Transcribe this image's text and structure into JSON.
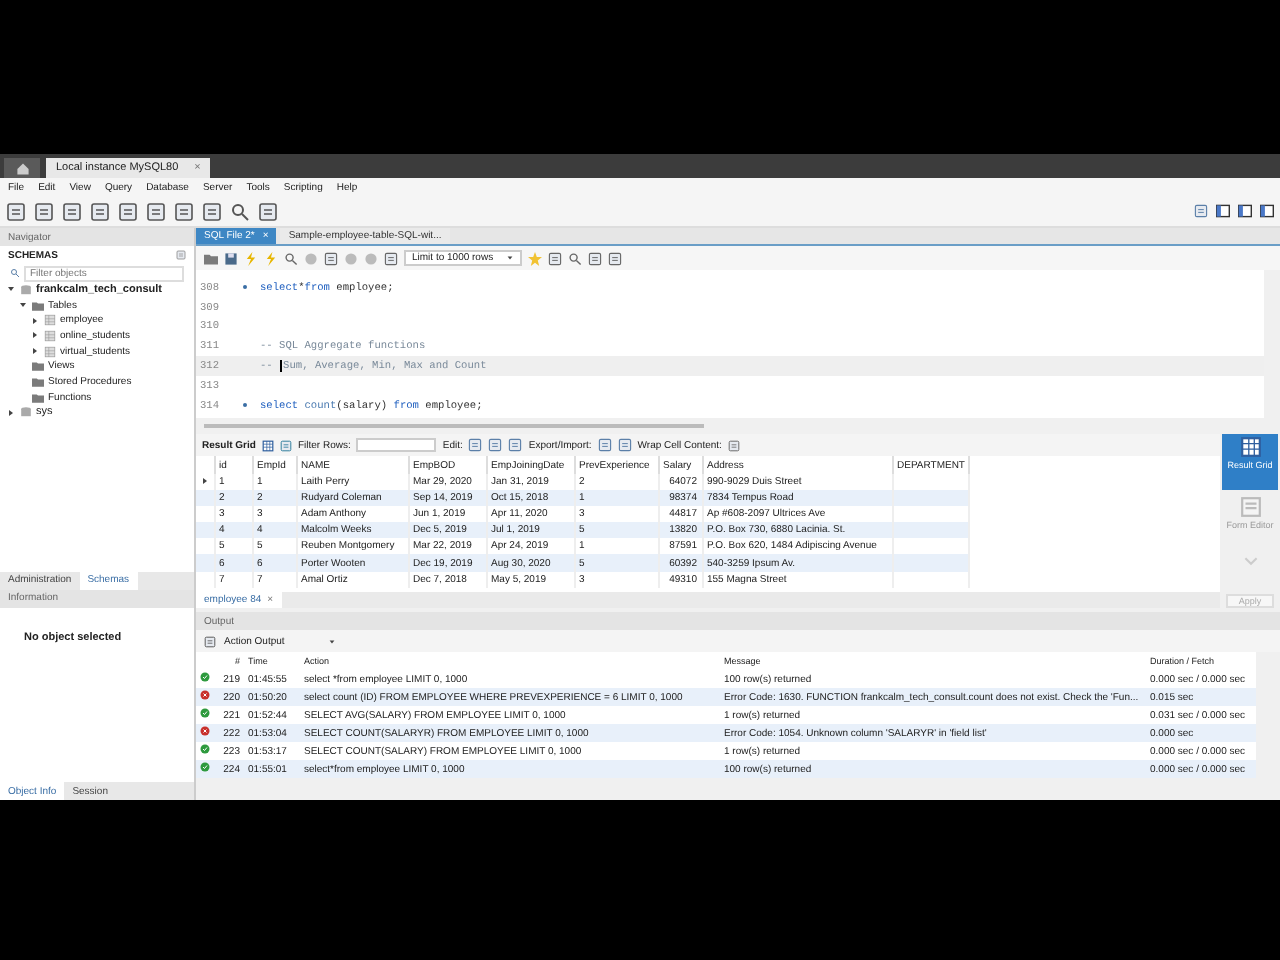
{
  "window_tabs": [
    {
      "label": "Local instance MySQL80",
      "close": "×"
    }
  ],
  "menu": [
    "File",
    "Edit",
    "View",
    "Query",
    "Database",
    "Server",
    "Tools",
    "Scripting",
    "Help"
  ],
  "navigator": {
    "title": "Navigator",
    "section": "SCHEMAS",
    "filter_placeholder": "Filter objects",
    "tree": [
      {
        "label": "frankcalm_tech_consult",
        "kind": "schema",
        "expanded": true,
        "children": [
          {
            "label": "Tables",
            "kind": "folder",
            "expanded": true,
            "children": [
              {
                "label": "employee",
                "kind": "table",
                "expanded": false
              },
              {
                "label": "online_students",
                "kind": "table",
                "expanded": false
              },
              {
                "label": "virtual_students",
                "kind": "table",
                "expanded": false
              }
            ]
          },
          {
            "label": "Views",
            "kind": "folder"
          },
          {
            "label": "Stored Procedures",
            "kind": "folder"
          },
          {
            "label": "Functions",
            "kind": "folder"
          }
        ]
      },
      {
        "label": "sys",
        "kind": "schema",
        "expanded": false
      }
    ],
    "tabs": [
      {
        "label": "Administration",
        "selected": false
      },
      {
        "label": "Schemas",
        "selected": true
      }
    ]
  },
  "information": {
    "title": "Information",
    "message": "No object selected",
    "tabs": [
      {
        "label": "Object Info",
        "selected": true
      },
      {
        "label": "Session",
        "selected": false
      }
    ]
  },
  "editor_tabs": [
    {
      "label": "SQL File 2*",
      "close": "×",
      "selected": true
    },
    {
      "label": "Sample-employee-table-SQL-wit...",
      "selected": false
    }
  ],
  "limit": "Limit to 1000 rows",
  "code_lines": [
    {
      "number": "308",
      "statement": true,
      "current": false,
      "tokens": [
        {
          "text": "select",
          "kind": "keyword"
        },
        {
          "text": "*",
          "kind": "plain"
        },
        {
          "text": "from",
          "kind": "keyword"
        },
        {
          "text": " employee;",
          "kind": "plain"
        }
      ]
    },
    {
      "number": "309",
      "statement": false,
      "current": false
    },
    {
      "number": "310",
      "statement": false,
      "current": false
    },
    {
      "number": "311",
      "statement": false,
      "current": false,
      "tokens": [
        {
          "text": "-- SQL Aggregate functions",
          "kind": "comment"
        }
      ]
    },
    {
      "number": "312",
      "statement": false,
      "current": true,
      "tokens": [
        {
          "text": "-- ",
          "kind": "comment"
        },
        {
          "text": "Sum, Average, Min, Max and Count",
          "kind": "comment"
        }
      ]
    },
    {
      "number": "313",
      "statement": false,
      "current": false
    },
    {
      "number": "314",
      "statement": true,
      "current": false,
      "tokens": [
        {
          "text": "select",
          "kind": "keyword"
        },
        {
          "text": " count",
          "kind": "function"
        },
        {
          "text": "(salary) ",
          "kind": "plain"
        },
        {
          "text": "from",
          "kind": "keyword"
        },
        {
          "text": " employee;",
          "kind": "plain"
        }
      ]
    }
  ],
  "result": {
    "grid_label": "Result Grid",
    "filter_label": "Filter Rows:",
    "edit_label": "Edit:",
    "export_label": "Export/Import:",
    "wrap_label": "Wrap Cell Content:",
    "columns": [
      "id",
      "EmpId",
      "NAME",
      "EmpBOD",
      "EmpJoiningDate",
      "PrevExperience",
      "Salary",
      "Address",
      "DEPARTMENT"
    ],
    "rows": [
      {
        "current": true,
        "cells": [
          "1",
          "1",
          "Laith Perry",
          "Mar 29, 2020",
          "Jan 31, 2019",
          "2",
          "64072",
          "990-9029 Duis Street",
          ""
        ]
      },
      {
        "current": false,
        "cells": [
          "2",
          "2",
          "Rudyard Coleman",
          "Sep 14, 2019",
          "Oct 15, 2018",
          "1",
          "98374",
          "7834 Tempus Road",
          ""
        ]
      },
      {
        "current": false,
        "cells": [
          "3",
          "3",
          "Adam Anthony",
          "Jun 1, 2019",
          "Apr 11, 2020",
          "3",
          "44817",
          "Ap #608-2097 Ultrices Ave",
          ""
        ]
      },
      {
        "current": false,
        "cells": [
          "4",
          "4",
          "Malcolm Weeks",
          "Dec 5, 2019",
          "Jul 1, 2019",
          "5",
          "13820",
          "P.O. Box 730, 6880 Lacinia. St.",
          ""
        ]
      },
      {
        "current": false,
        "cells": [
          "5",
          "5",
          "Reuben Montgomery",
          "Mar 22, 2019",
          "Apr 24, 2019",
          "1",
          "87591",
          "P.O. Box 620, 1484 Adipiscing Avenue",
          ""
        ]
      },
      {
        "current": false,
        "cells": [
          "6",
          "6",
          "Porter Wooten",
          "Dec 19, 2019",
          "Aug 30, 2020",
          "5",
          "60392",
          "540-3259 Ipsum Av.",
          ""
        ]
      },
      {
        "current": false,
        "cells": [
          "7",
          "7",
          "Amal Ortiz",
          "Dec 7, 2018",
          "May 5, 2019",
          "3",
          "49310",
          "155 Magna Street",
          ""
        ]
      }
    ],
    "tabs": [
      {
        "label": "employee 84",
        "close": "×"
      }
    ]
  },
  "side_buttons": [
    {
      "label": "Result Grid",
      "selected": true
    },
    {
      "label": "Form Editor",
      "selected": false
    }
  ],
  "apply": {
    "label": "Apply",
    "disabled": true
  },
  "output": {
    "title": "Output",
    "selector": "Action Output",
    "columns": [
      "#",
      "Time",
      "Action",
      "Message",
      "Duration / Fetch"
    ],
    "rows": [
      {
        "kind": "ok",
        "number": "219",
        "time": "01:45:55",
        "action": "select *from employee LIMIT 0, 1000",
        "message": "100 row(s) returned",
        "duration": "0.000 sec / 0.000 sec"
      },
      {
        "kind": "error",
        "number": "220",
        "time": "01:50:20",
        "action": "select count (ID) FROM EMPLOYEE WHERE PREVEXPERIENCE = 6 LIMIT 0, 1000",
        "message": "Error Code: 1630. FUNCTION frankcalm_tech_consult.count does not exist. Check the 'Fun...",
        "duration": "0.015 sec"
      },
      {
        "kind": "ok",
        "number": "221",
        "time": "01:52:44",
        "action": "SELECT AVG(SALARY) FROM EMPLOYEE LIMIT 0, 1000",
        "message": "1 row(s) returned",
        "duration": "0.031 sec / 0.000 sec"
      },
      {
        "kind": "error",
        "number": "222",
        "time": "01:53:04",
        "action": "SELECT COUNT(SALARYR) FROM EMPLOYEE LIMIT 0, 1000",
        "message": "Error Code: 1054. Unknown column 'SALARYR' in 'field list'",
        "duration": "0.000 sec"
      },
      {
        "kind": "ok",
        "number": "223",
        "time": "01:53:17",
        "action": "SELECT COUNT(SALARY) FROM EMPLOYEE LIMIT 0, 1000",
        "message": "1 row(s) returned",
        "duration": "0.000 sec / 0.000 sec"
      },
      {
        "kind": "ok",
        "number": "224",
        "time": "01:55:01",
        "action": "select*from employee LIMIT 0, 1000",
        "message": "100 row(s) returned",
        "duration": "0.000 sec / 0.000 sec"
      }
    ]
  }
}
